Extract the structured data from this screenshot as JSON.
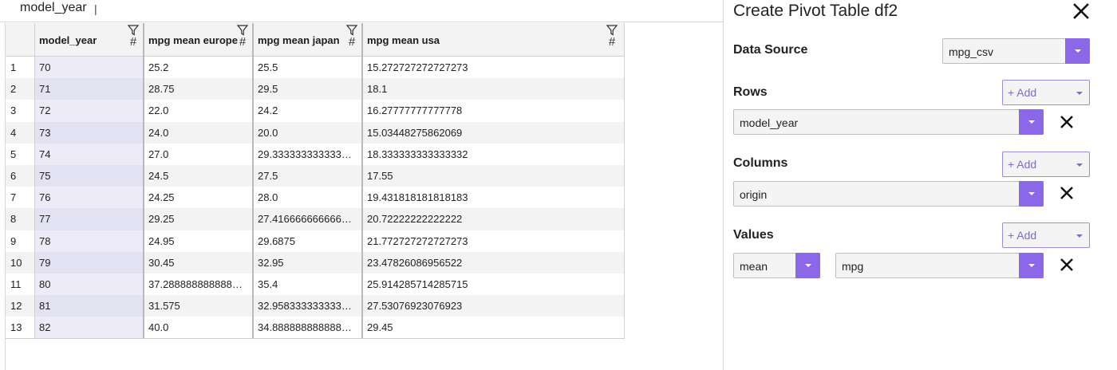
{
  "grid": {
    "title": "model_year",
    "title_caret": "|",
    "columns": [
      "model_year",
      "mpg mean europe",
      "mpg mean japan",
      "mpg mean usa"
    ],
    "rows": [
      [
        "1",
        "70",
        "25.2",
        "25.5",
        "15.272727272727273"
      ],
      [
        "2",
        "71",
        "28.75",
        "29.5",
        "18.1"
      ],
      [
        "3",
        "72",
        "22.0",
        "24.2",
        "16.27777777777778"
      ],
      [
        "4",
        "73",
        "24.0",
        "20.0",
        "15.03448275862069"
      ],
      [
        "5",
        "74",
        "27.0",
        "29.333333333333…",
        "18.333333333333332"
      ],
      [
        "6",
        "75",
        "24.5",
        "27.5",
        "17.55"
      ],
      [
        "7",
        "76",
        "24.25",
        "28.0",
        "19.431818181818183"
      ],
      [
        "8",
        "77",
        "29.25",
        "27.416666666666…",
        "20.72222222222222"
      ],
      [
        "9",
        "78",
        "24.95",
        "29.6875",
        "21.772727272727273"
      ],
      [
        "10",
        "79",
        "30.45",
        "32.95",
        "23.47826086956522"
      ],
      [
        "11",
        "80",
        "37.288888888888…",
        "35.4",
        "25.914285714285715"
      ],
      [
        "12",
        "81",
        "31.575",
        "32.958333333333…",
        "27.53076923076923"
      ],
      [
        "13",
        "82",
        "40.0",
        "34.888888888888…",
        "29.45"
      ]
    ]
  },
  "panel": {
    "title": "Create Pivot Table df2",
    "data_source": {
      "label": "Data Source",
      "value": "mpg_csv"
    },
    "rows": {
      "label": "Rows",
      "add_label": "+ Add",
      "value": "model_year"
    },
    "columns": {
      "label": "Columns",
      "add_label": "+ Add",
      "value": "origin"
    },
    "values": {
      "label": "Values",
      "add_label": "+ Add",
      "agg": "mean",
      "field": "mpg"
    }
  },
  "colors": {
    "accent": "#8b68e8",
    "add_text": "#7d6ad6",
    "index_highlight": "#ecebf7"
  }
}
